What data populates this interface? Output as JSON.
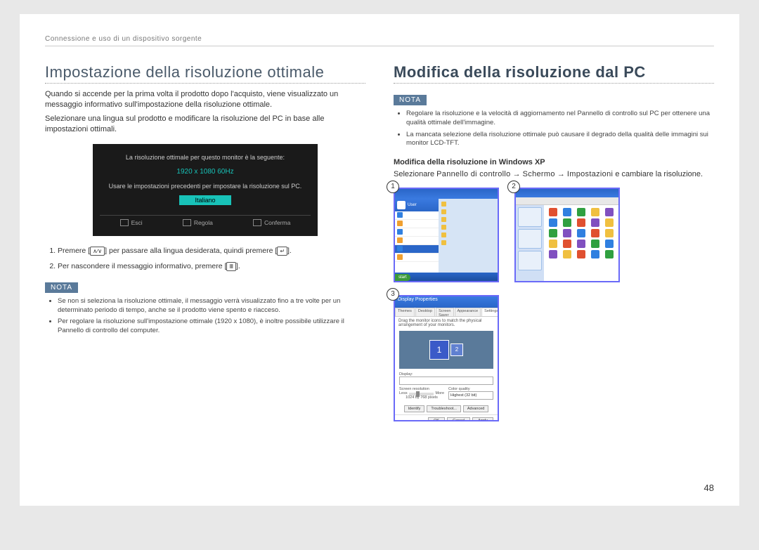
{
  "header": "Connessione e uso di un dispositivo sorgente",
  "page_number": "48",
  "left": {
    "title": "Impostazione della risoluzione ottimale",
    "p1": "Quando si accende per la prima volta il prodotto dopo l'acquisto, viene visualizzato un messaggio informativo sull'impostazione della risoluzione ottimale.",
    "p2": "Selezionare una lingua sul prodotto e modificare la risoluzione del PC in base alle impostazioni ottimali.",
    "osd": {
      "line1": "La risoluzione ottimale per questo monitor è la seguente:",
      "resolution": "1920 x 1080  60Hz",
      "line2": "Usare le impostazioni precedenti per impostare la risoluzione sul PC.",
      "lang_button": "Italiano",
      "bar": {
        "esci": "Esci",
        "regola": "Regola",
        "conferma": "Conferma"
      }
    },
    "step1_pre": "Premere [",
    "step1_post": "] per passare alla lingua desiderata, quindi premere [",
    "step1_end": "].",
    "step2_pre": "Per nascondere il messaggio informativo, premere [",
    "step2_end": "].",
    "nota_label": "NOTA",
    "nota_items": [
      "Se non si seleziona la risoluzione ottimale, il messaggio verrà visualizzato fino a tre volte per un determinato periodo di tempo, anche se il prodotto viene spento e riacceso.",
      "Per regolare la risoluzione sull'impostazione ottimale (1920 x 1080), è inoltre possibile utilizzare il Pannello di controllo del computer."
    ]
  },
  "right": {
    "title": "Modifica della risoluzione dal PC",
    "nota_label": "NOTA",
    "nota_items": [
      "Regolare la risoluzione e la velocità di aggiornamento nel Pannello di controllo sul PC per ottenere una qualità ottimale dell'immagine.",
      "La mancata selezione della risoluzione ottimale può causare il degrado della qualità delle immagini sui monitor LCD-TFT."
    ],
    "subhead": "Modifica della risoluzione in Windows XP",
    "instr_pre": "Selezionare ",
    "instr_p1": "Pannello di controllo",
    "instr_arrow": " → ",
    "instr_p2": "Schermo",
    "instr_p3": "Impostazioni",
    "instr_post": " e cambiare la risoluzione.",
    "thumbs": {
      "n1": "1",
      "n2": "2",
      "n3": "3",
      "t1": {
        "user": "User",
        "start": "start"
      },
      "t3": {
        "title": "Display Properties",
        "tabs": [
          "Themes",
          "Desktop",
          "Screen Saver",
          "Appearance",
          "Settings"
        ],
        "desc": "Drag the monitor icons to match the physical arrangement of your monitors.",
        "mon1": "1",
        "mon2": "2",
        "disp_lbl": "Display:",
        "res_lbl": "Screen resolution",
        "res_minus": "Less",
        "res_plus": "More",
        "res_val": "1024 by 768 pixels",
        "cq_lbl": "Color quality",
        "cq_val": "Highest (32 bit)",
        "btn_identify": "Identify",
        "btn_trouble": "Troubleshoot...",
        "btn_adv": "Advanced",
        "btn_ok": "OK",
        "btn_cancel": "Cancel",
        "btn_apply": "Apply"
      }
    }
  }
}
